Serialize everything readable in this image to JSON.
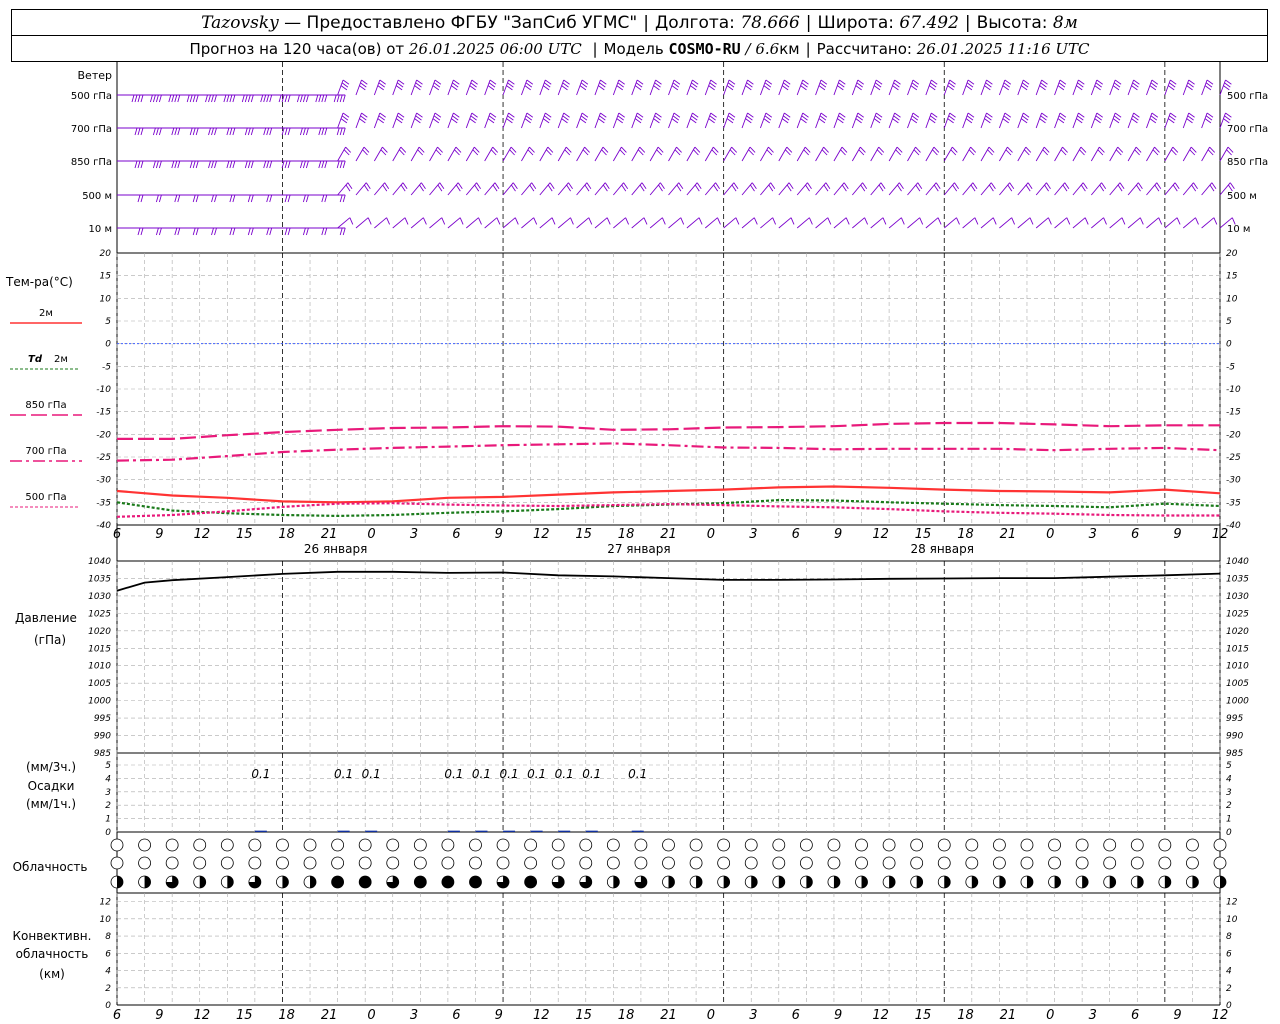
{
  "header": {
    "station": "Tazovsky",
    "provided_by": " — Предоставлено ФГБУ \"ЗапСиб УГМС\"",
    "lon_label": "Долгота:",
    "lon": "78.666",
    "lat_label": "Широта:",
    "lat": "67.492",
    "alt_label": "Высота:",
    "alt": "8м",
    "forecast_prefix": "Прогноз на 120 часа(ов)  от",
    "forecast_start": "26.01.2025 06:00 UTC",
    "model_label": "Модель",
    "model": "COSMO-RU",
    "resolution": "/ 6.6",
    "resolution_unit": "км",
    "calc_label": "Рассчитано:",
    "calc_time": "26.01.2025 11:16 UTC"
  },
  "colors": {
    "t2m": "#ff3333",
    "td2m": "#1a7a1a",
    "t850": "#e8197a",
    "t700": "#e8197a",
    "t500": "#e8197a",
    "zero_line": "#4060ff",
    "wind": "#7a00cc",
    "pressure": "#000000"
  },
  "labels": {
    "wind": "Ветер",
    "wind_levels": [
      "500 гПа",
      "700 гПа",
      "850 гПа",
      "500  м",
      "10   м"
    ],
    "temp": "Тем-ра(°C)",
    "legend_2m": "2м",
    "legend_td_sym": "Td",
    "legend_td": "2м",
    "legend_850": "850 гПа",
    "legend_700": "700 гПа",
    "legend_500": "500 гПа",
    "pressure": "Давление",
    "pressure_unit": "(гПа)",
    "precip_unit3": "(мм/3ч.)",
    "precip": "Осадки",
    "precip_unit1": "(мм/1ч.)",
    "cloud": "Облачность",
    "conv1": "Конвективн.",
    "conv2": "облачность",
    "conv3": "(км)"
  },
  "chart_data": {
    "type": "line",
    "x_hours_from_start": [
      0,
      120
    ],
    "hour_tick_labels": [
      "6",
      "9",
      "12",
      "15",
      "18",
      "21",
      "0",
      "3",
      "6",
      "9",
      "12",
      "15",
      "18",
      "21",
      "0",
      "3",
      "6",
      "9",
      "12",
      "15",
      "18",
      "21",
      "0",
      "3",
      "6",
      "9",
      "12"
    ],
    "day_labels": [
      "26 января",
      "27 января",
      "28 января"
    ],
    "temperature": {
      "ylim": [
        -40,
        20
      ],
      "ticks": [
        20,
        15,
        10,
        5,
        0,
        -5,
        -10,
        -15,
        -20,
        -25,
        -30,
        -35,
        -40
      ],
      "series": [
        {
          "name": "2м",
          "key": "t2m",
          "x": [
            0,
            6,
            12,
            18,
            24,
            30,
            36,
            42,
            48,
            54,
            60,
            66,
            72,
            78,
            84,
            90,
            96,
            102,
            108,
            114,
            120
          ],
          "values": [
            -32.5,
            -33.5,
            -34,
            -34.8,
            -35,
            -34.8,
            -34,
            -33.8,
            -33.3,
            -32.8,
            -32.5,
            -32.2,
            -31.7,
            -31.5,
            -31.8,
            -32.2,
            -32.5,
            -32.6,
            -32.8,
            -32.2,
            -33
          ]
        },
        {
          "name": "Td 2м",
          "key": "td2m",
          "x": [
            0,
            6,
            12,
            18,
            24,
            30,
            36,
            42,
            48,
            54,
            60,
            66,
            72,
            78,
            84,
            90,
            96,
            102,
            108,
            114,
            120
          ],
          "values": [
            -35,
            -36.8,
            -37.4,
            -37.8,
            -38,
            -37.8,
            -37.3,
            -37,
            -36.5,
            -35.8,
            -35.5,
            -35.2,
            -34.5,
            -34.6,
            -35,
            -35.3,
            -35.6,
            -35.8,
            -36.1,
            -35.3,
            -35.8
          ]
        },
        {
          "name": "850 гПа",
          "key": "t850",
          "x": [
            0,
            6,
            12,
            18,
            24,
            30,
            36,
            42,
            48,
            54,
            60,
            66,
            72,
            78,
            84,
            90,
            96,
            102,
            108,
            114,
            120
          ],
          "values": [
            -21,
            -21,
            -20.2,
            -19.5,
            -19,
            -18.6,
            -18.5,
            -18.2,
            -18.3,
            -19,
            -18.9,
            -18.5,
            -18.4,
            -18.2,
            -17.7,
            -17.5,
            -17.5,
            -17.8,
            -18.2,
            -18,
            -18
          ]
        },
        {
          "name": "700 гПа",
          "key": "t700",
          "x": [
            0,
            6,
            12,
            18,
            24,
            30,
            36,
            42,
            48,
            54,
            60,
            66,
            72,
            78,
            84,
            90,
            96,
            102,
            108,
            114,
            120
          ],
          "values": [
            -25.8,
            -25.6,
            -24.8,
            -23.9,
            -23.4,
            -23,
            -22.7,
            -22.4,
            -22.2,
            -22,
            -22.4,
            -22.9,
            -23,
            -23.3,
            -23.2,
            -23.2,
            -23.2,
            -23.5,
            -23.2,
            -23,
            -23.5
          ]
        },
        {
          "name": "500 гПа",
          "key": "t500",
          "x": [
            0,
            6,
            12,
            18,
            24,
            30,
            36,
            42,
            48,
            54,
            60,
            66,
            72,
            78,
            84,
            90,
            96,
            102,
            108,
            114,
            120
          ],
          "values": [
            -38.2,
            -37.8,
            -37,
            -36,
            -35.3,
            -35.2,
            -35.5,
            -35.7,
            -35.8,
            -35.6,
            -35.4,
            -35.6,
            -35.9,
            -36.1,
            -36.5,
            -37,
            -37.3,
            -37.5,
            -37.8,
            -37.9,
            -37.9
          ]
        }
      ]
    },
    "pressure": {
      "ylim": [
        985,
        1040
      ],
      "ticks": [
        1040,
        1035,
        1030,
        1025,
        1020,
        1015,
        1010,
        1005,
        1000,
        995,
        990,
        985
      ],
      "x": [
        0,
        3,
        6,
        12,
        18,
        24,
        30,
        36,
        42,
        48,
        54,
        60,
        66,
        72,
        78,
        84,
        90,
        96,
        102,
        108,
        114,
        120
      ],
      "values": [
        1031.5,
        1033.8,
        1034.5,
        1035.4,
        1036.3,
        1036.9,
        1036.9,
        1036.6,
        1036.7,
        1035.9,
        1035.6,
        1035.1,
        1034.6,
        1034.6,
        1034.7,
        1034.9,
        1035.0,
        1035.1,
        1035.1,
        1035.5,
        1035.9,
        1036.4
      ]
    },
    "precipitation": {
      "ylim": [
        0,
        5
      ],
      "ticks": [
        5,
        4,
        3,
        2,
        1,
        0
      ],
      "x": [
        15,
        24,
        27,
        36,
        39,
        42,
        45,
        48,
        51,
        56
      ],
      "values": [
        0.1,
        0.1,
        0.1,
        0.1,
        0.1,
        0.1,
        0.1,
        0.1,
        0.1,
        0.1
      ],
      "labels": [
        "0.1",
        "0.1",
        "0.1",
        "0.1",
        "0.1",
        "0.1",
        "0.1",
        "0.1",
        "0.1",
        "0.1"
      ]
    },
    "cloud_cover": {
      "upper_total": 0,
      "middle_total": 0,
      "lower_fraction_x": [
        0,
        3,
        6,
        9,
        12,
        15,
        18,
        21,
        24,
        27,
        30,
        33,
        36,
        39,
        42,
        45,
        48,
        51,
        54,
        57,
        60,
        63,
        66,
        69,
        72,
        75,
        78,
        81,
        84,
        87,
        90,
        93,
        96,
        99,
        102,
        105,
        108,
        111,
        114,
        117,
        120
      ],
      "lower_fraction": [
        0.5,
        0.5,
        0.75,
        0.5,
        0.5,
        0.75,
        0.5,
        0.5,
        1,
        1,
        0.75,
        1,
        1,
        1,
        0.75,
        1,
        0.75,
        0.75,
        0.5,
        0.75,
        0.5,
        0.5,
        0.5,
        0.5,
        0.5,
        0.5,
        0.5,
        0.5,
        0.5,
        0.5,
        0.5,
        0.5,
        0.5,
        0.5,
        0.5,
        0.5,
        0.5,
        0.5,
        0.5,
        0.5,
        0.5
      ]
    },
    "convective_cloud": {
      "ylim": [
        0,
        13
      ],
      "ticks": [
        12,
        10,
        8,
        6,
        4,
        2,
        0
      ],
      "values": []
    },
    "wind": {
      "levels": [
        "500 гПа",
        "700 гПа",
        "850 гПа",
        "500 м",
        "10 м"
      ],
      "direction_deg_first_day": [
        270,
        270,
        270,
        270,
        270
      ],
      "direction_deg_later": [
        200,
        200,
        210,
        220,
        230
      ],
      "speed_kt_first_day": [
        35,
        30,
        25,
        20,
        15
      ],
      "speed_kt_later": [
        25,
        25,
        20,
        15,
        10
      ]
    }
  }
}
